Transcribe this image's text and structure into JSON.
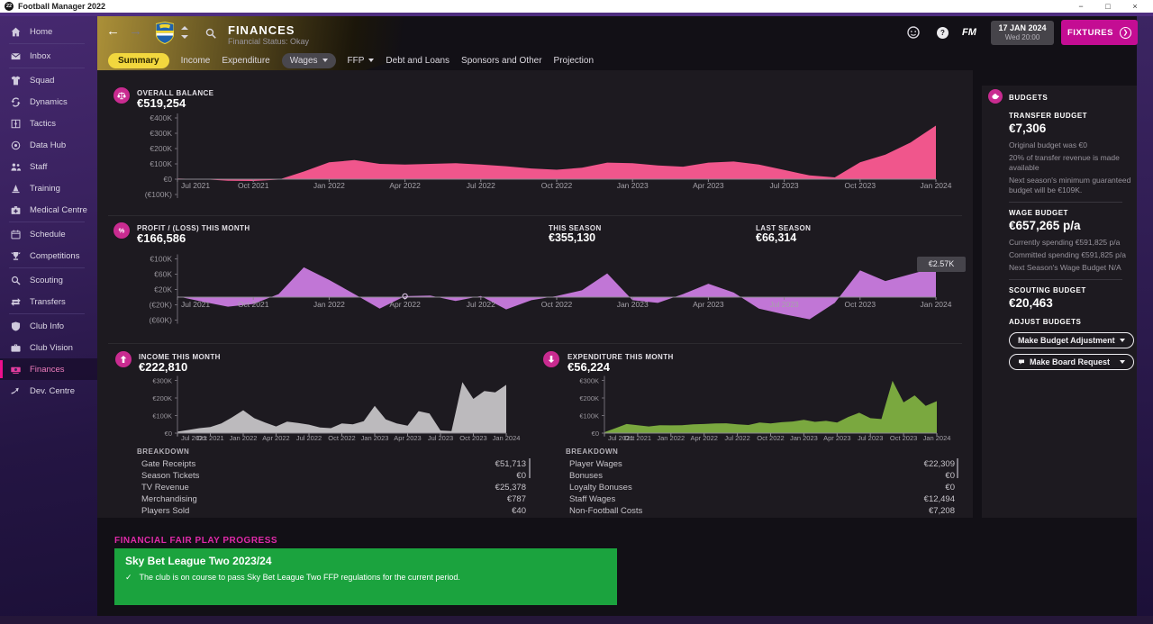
{
  "app": {
    "title": "Football Manager 2022",
    "logo": "22",
    "window": {
      "minimize": "−",
      "maximize": "□",
      "close": "×"
    }
  },
  "sidebar": {
    "selected": "Finances",
    "items": [
      {
        "label": "Home",
        "icon": "home"
      },
      {
        "label": "Inbox",
        "icon": "inbox"
      },
      {
        "label": "Squad",
        "icon": "squad"
      },
      {
        "label": "Dynamics",
        "icon": "dynamics"
      },
      {
        "label": "Tactics",
        "icon": "tactics"
      },
      {
        "label": "Data Hub",
        "icon": "data-hub"
      },
      {
        "label": "Staff",
        "icon": "staff"
      },
      {
        "label": "Training",
        "icon": "training"
      },
      {
        "label": "Medical Centre",
        "icon": "medical"
      },
      {
        "label": "Schedule",
        "icon": "schedule"
      },
      {
        "label": "Competitions",
        "icon": "competitions"
      },
      {
        "label": "Scouting",
        "icon": "scouting"
      },
      {
        "label": "Transfers",
        "icon": "transfers"
      },
      {
        "label": "Club Info",
        "icon": "club-info"
      },
      {
        "label": "Club Vision",
        "icon": "club-vision"
      },
      {
        "label": "Finances",
        "icon": "finances"
      },
      {
        "label": "Dev. Centre",
        "icon": "dev-centre"
      }
    ]
  },
  "header": {
    "title": "FINANCES",
    "subtitle": "Financial Status: Okay",
    "fm_logo": "FM",
    "date": {
      "day": "17 JAN 2024",
      "time": "Wed 20:00"
    },
    "fixtures_label": "FIXTURES",
    "fixtures_arrow": "❯"
  },
  "tabs": [
    {
      "label": "Summary",
      "active": true,
      "dropdown": false
    },
    {
      "label": "Income",
      "active": false,
      "dropdown": false
    },
    {
      "label": "Expenditure",
      "active": false,
      "dropdown": false
    },
    {
      "label": "Wages",
      "active": false,
      "dropdown": true
    },
    {
      "label": "FFP",
      "active": false,
      "dropdown": true
    },
    {
      "label": "Debt and Loans",
      "active": false,
      "dropdown": false
    },
    {
      "label": "Sponsors and Other",
      "active": false,
      "dropdown": false
    },
    {
      "label": "Projection",
      "active": false,
      "dropdown": false
    }
  ],
  "breakdown": {
    "income": {
      "title": "BREAKDOWN",
      "rows": [
        {
          "item": "Gate Receipts",
          "value": "€51,713"
        },
        {
          "item": "Season Tickets",
          "value": "€0"
        },
        {
          "item": "TV Revenue",
          "value": "€25,378"
        },
        {
          "item": "Merchandising",
          "value": "€787"
        },
        {
          "item": "Players Sold",
          "value": "€40"
        }
      ]
    },
    "expenditure": {
      "title": "BREAKDOWN",
      "rows": [
        {
          "item": "Player Wages",
          "value": "€22,309"
        },
        {
          "item": "Bonuses",
          "value": "€0"
        },
        {
          "item": "Loyalty Bonuses",
          "value": "€0"
        },
        {
          "item": "Staff Wages",
          "value": "€12,494"
        },
        {
          "item": "Non-Football Costs",
          "value": "€7,208"
        }
      ]
    }
  },
  "budgets": {
    "panel_title": "BUDGETS",
    "transfer": {
      "label": "TRANSFER BUDGET",
      "value": "€7,306",
      "notes": [
        "Original budget was €0",
        "20% of transfer revenue is made available",
        "Next season's minimum guaranteed budget will be €109K."
      ]
    },
    "wage": {
      "label": "WAGE BUDGET",
      "value": "€657,265 p/a",
      "notes": [
        "Currently spending €591,825 p/a",
        "Committed spending €591,825 p/a",
        "Next Season's Wage Budget N/A"
      ]
    },
    "scouting": {
      "label": "SCOUTING BUDGET",
      "value": "€20,463"
    },
    "adjust": {
      "label": "ADJUST BUDGETS",
      "options": [
        {
          "label": "Make Budget Adjustment"
        },
        {
          "label": "Make Board Request"
        }
      ]
    }
  },
  "ffp": {
    "heading": "FINANCIAL FAIR PLAY PROGRESS",
    "card_title": "Sky Bet League Two 2023/24",
    "check": "✓",
    "card_text": "The club is on course to pass Sky Bet League Two FFP regulations for the current period."
  },
  "chart_data": {
    "unit": "EUR thousands",
    "x_months": [
      "Jul 2021",
      "Aug 2021",
      "Sep 2021",
      "Oct 2021",
      "Nov 2021",
      "Dec 2021",
      "Jan 2022",
      "Feb 2022",
      "Mar 2022",
      "Apr 2022",
      "May 2022",
      "Jun 2022",
      "Jul 2022",
      "Aug 2022",
      "Sep 2022",
      "Oct 2022",
      "Nov 2022",
      "Dec 2022",
      "Jan 2023",
      "Feb 2023",
      "Mar 2023",
      "Apr 2023",
      "May 2023",
      "Jun 2023",
      "Jul 2023",
      "Aug 2023",
      "Sep 2023",
      "Oct 2023",
      "Nov 2023",
      "Dec 2023",
      "Jan 2024"
    ],
    "x_quarter_labels": [
      "Jul 2021",
      "Oct 2021",
      "Jan 2022",
      "Apr 2022",
      "Jul 2022",
      "Oct 2022",
      "Jan 2023",
      "Apr 2023",
      "Jul 2023",
      "Oct 2023",
      "Jan 2024"
    ],
    "charts": [
      {
        "id": "overall-balance",
        "type": "area",
        "title": "OVERALL BALANCE",
        "current_value": "€519,254",
        "color": "#f0568c",
        "ylim": [
          -100,
          400
        ],
        "yticks": [
          {
            "v": 400,
            "label": "€400K"
          },
          {
            "v": 300,
            "label": "€300K"
          },
          {
            "v": 200,
            "label": "€200K"
          },
          {
            "v": 100,
            "label": "€100K"
          },
          {
            "v": 0,
            "label": "€0"
          },
          {
            "v": -100,
            "label": "(€100K)"
          }
        ],
        "values": [
          5,
          0,
          -10,
          -12,
          -3,
          50,
          110,
          125,
          100,
          95,
          100,
          105,
          95,
          85,
          70,
          62,
          75,
          108,
          105,
          90,
          82,
          108,
          115,
          95,
          60,
          25,
          12,
          110,
          160,
          240,
          350
        ]
      },
      {
        "id": "profit-loss",
        "type": "area",
        "title": "PROFIT / (LOSS) THIS MONTH",
        "current_value": "€166,586",
        "this_season": {
          "label": "THIS SEASON",
          "value": "€355,130"
        },
        "last_season": {
          "label": "LAST SEASON",
          "value": "€66,314"
        },
        "color": "#c176d6",
        "ylim": [
          -80,
          110
        ],
        "yticks": [
          {
            "v": 100,
            "label": "€100K"
          },
          {
            "v": 60,
            "label": "€60K"
          },
          {
            "v": 20,
            "label": "€20K"
          },
          {
            "v": -20,
            "label": "(€20K)"
          },
          {
            "v": -60,
            "label": "(€60K)"
          }
        ],
        "values": [
          2,
          -12,
          -25,
          -18,
          8,
          78,
          45,
          8,
          -30,
          2.57,
          4,
          -10,
          3,
          -32,
          -8,
          3,
          18,
          62,
          -8,
          -15,
          8,
          35,
          12,
          -30,
          -45,
          -58,
          -15,
          70,
          42,
          60,
          78
        ],
        "hover_marker": {
          "month": "Apr 2022",
          "value_label": "€2.57K"
        }
      },
      {
        "id": "income",
        "type": "area",
        "title": "INCOME THIS MONTH",
        "current_value": "€222,810",
        "color": "#bcbabd",
        "ylim": [
          0,
          320
        ],
        "yticks": [
          {
            "v": 300,
            "label": "€300K"
          },
          {
            "v": 200,
            "label": "€200K"
          },
          {
            "v": 100,
            "label": "€100K"
          },
          {
            "v": 0,
            "label": "€0"
          }
        ],
        "values": [
          8,
          18,
          28,
          35,
          55,
          90,
          130,
          85,
          60,
          38,
          65,
          58,
          48,
          32,
          28,
          55,
          50,
          68,
          155,
          78,
          55,
          42,
          125,
          112,
          15,
          12,
          290,
          195,
          240,
          232,
          275
        ]
      },
      {
        "id": "expenditure",
        "type": "area",
        "title": "EXPENDITURE THIS MONTH",
        "current_value": "€56,224",
        "color": "#7aa83f",
        "ylim": [
          0,
          320
        ],
        "yticks": [
          {
            "v": 300,
            "label": "€300K"
          },
          {
            "v": 200,
            "label": "€200K"
          },
          {
            "v": 100,
            "label": "€100K"
          },
          {
            "v": 0,
            "label": "€0"
          }
        ],
        "values": [
          5,
          28,
          52,
          45,
          38,
          45,
          44,
          45,
          50,
          52,
          55,
          56,
          50,
          46,
          60,
          55,
          62,
          66,
          76,
          64,
          70,
          60,
          92,
          116,
          85,
          80,
          298,
          175,
          215,
          155,
          182
        ]
      }
    ]
  },
  "colors": {
    "accent_pink": "#c92b90",
    "fixtures_magenta": "#c40d93",
    "tab_yellow": "#f2d73e",
    "ffp_green": "#1ba33e",
    "chart_pink": "#f0568c",
    "chart_purple": "#c176d6",
    "chart_grey": "#bcbabd",
    "chart_green": "#7aa83f"
  }
}
